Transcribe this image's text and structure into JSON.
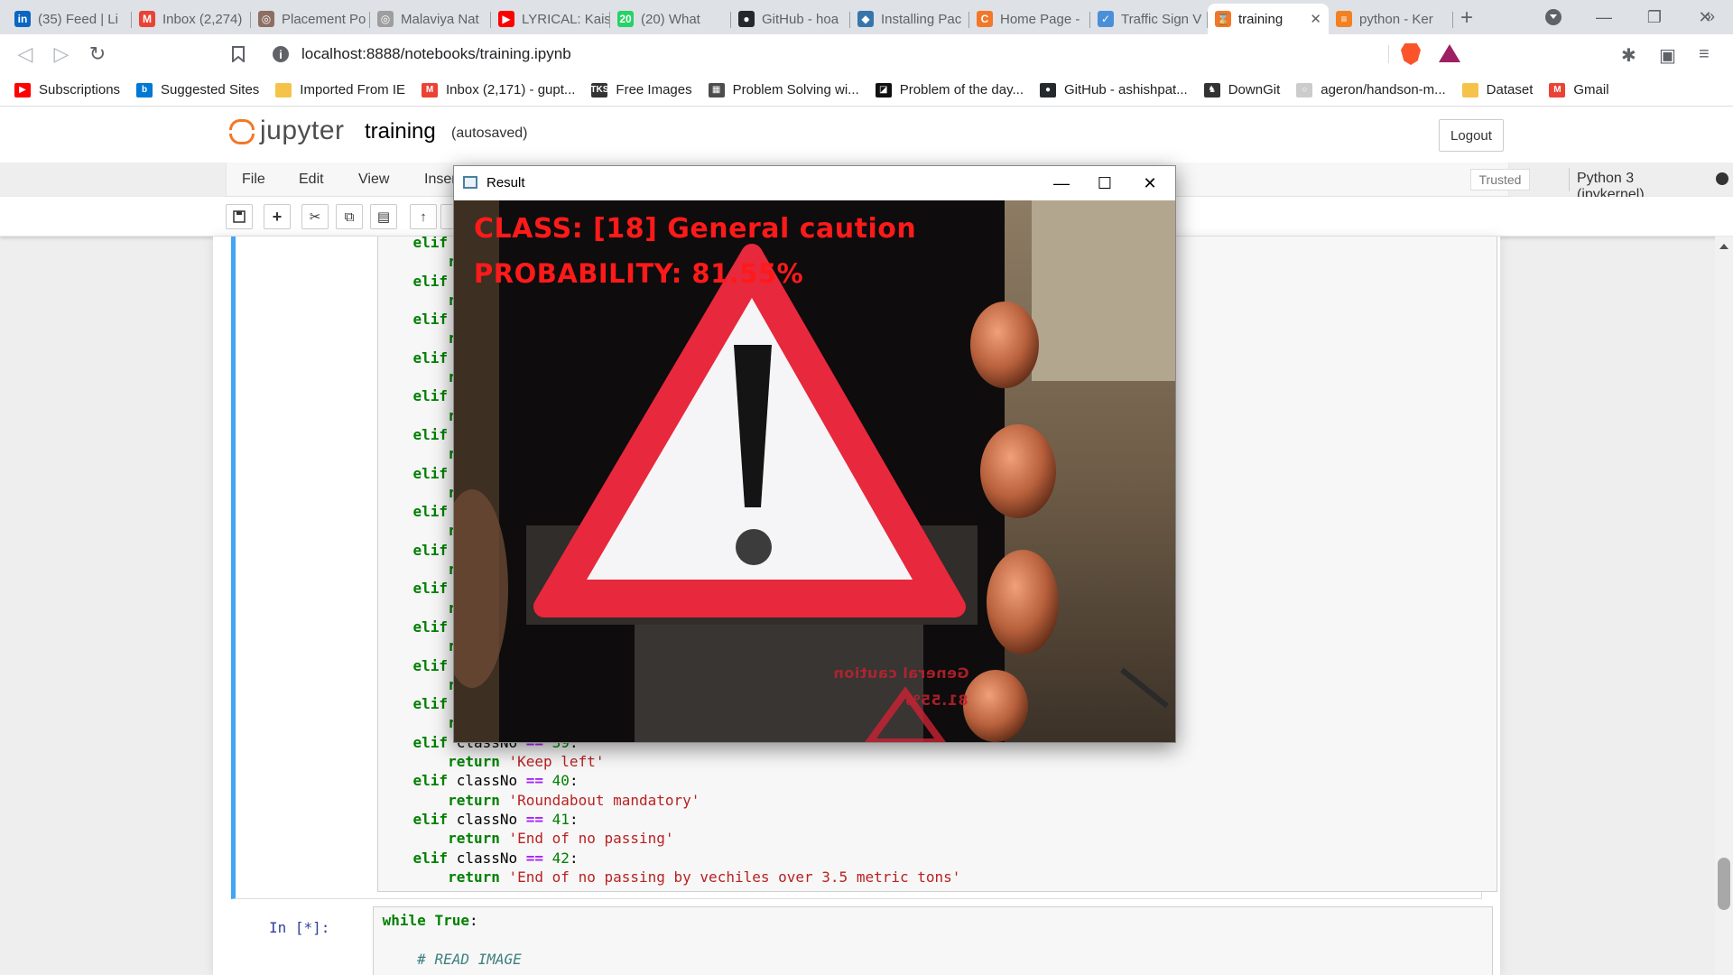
{
  "browser": {
    "tabs": [
      {
        "title": "(35) Feed | Li",
        "icon": "linkedin-icon",
        "color": "#0a66c2",
        "glyph": "in"
      },
      {
        "title": "Inbox (2,274)",
        "icon": "gmail-icon",
        "color": "#ea4335",
        "glyph": "M"
      },
      {
        "title": "Placement Po",
        "icon": "placement-icon",
        "color": "#8d6e63",
        "glyph": "◎"
      },
      {
        "title": "Malaviya Nat",
        "icon": "malaviya-icon",
        "color": "#9e9e9e",
        "glyph": "◎"
      },
      {
        "title": "LYRICAL: Kais",
        "icon": "youtube-icon",
        "color": "#ff0000",
        "glyph": "▶"
      },
      {
        "title": "(20) What",
        "icon": "whatsapp-icon",
        "color": "#25d366",
        "glyph": "20"
      },
      {
        "title": "GitHub - hoa",
        "icon": "github-icon",
        "color": "#24292e",
        "glyph": "●"
      },
      {
        "title": "Installing Pac",
        "icon": "python-icon",
        "color": "#3776ab",
        "glyph": "◆"
      },
      {
        "title": "Home Page -",
        "icon": "jupyter-icon",
        "color": "#f37726",
        "glyph": "C"
      },
      {
        "title": "Traffic Sign V",
        "icon": "traffic-icon",
        "color": "#4a90d9",
        "glyph": "✓"
      },
      {
        "title": "training",
        "icon": "hourglass-icon",
        "color": "#f37726",
        "glyph": "⌛",
        "active": true
      },
      {
        "title": "python - Ker",
        "icon": "stackoverflow-icon",
        "color": "#f48024",
        "glyph": "≡"
      }
    ],
    "url": "localhost:8888/notebooks/training.ipynb",
    "bookmarks": [
      {
        "label": "Subscriptions",
        "icon": "youtube-icon",
        "color": "#ff0000",
        "glyph": "▶"
      },
      {
        "label": "Suggested Sites",
        "icon": "bing-icon",
        "color": "#0078d4",
        "glyph": "b"
      },
      {
        "label": "Imported From IE",
        "icon": "folder-icon",
        "color": "#f6c34a",
        "glyph": ""
      },
      {
        "label": "Inbox (2,171) - gupt...",
        "icon": "gmail-icon",
        "color": "#ea4335",
        "glyph": "M"
      },
      {
        "label": "Free Images",
        "icon": "freeimages-icon",
        "color": "#333333",
        "glyph": "TKS"
      },
      {
        "label": "Problem Solving wi...",
        "icon": "runestone-icon",
        "color": "#4d4d4d",
        "glyph": "▦"
      },
      {
        "label": "Problem of the day...",
        "icon": "gfg-icon",
        "color": "#111111",
        "glyph": "◪"
      },
      {
        "label": "GitHub - ashishpat...",
        "icon": "github-icon",
        "color": "#24292e",
        "glyph": "●"
      },
      {
        "label": "DownGit",
        "icon": "downgit-icon",
        "color": "#333333",
        "glyph": "♞"
      },
      {
        "label": "ageron/handson-m...",
        "icon": "github-icon",
        "color": "#cccccc",
        "glyph": "○"
      },
      {
        "label": "Dataset",
        "icon": "folder-icon",
        "color": "#f6c34a",
        "glyph": ""
      },
      {
        "label": "Gmail",
        "icon": "gmail-icon",
        "color": "#ea4335",
        "glyph": "M"
      }
    ]
  },
  "jupyter": {
    "logo_text": "jupyter",
    "notebook_name": "training",
    "autosave": "(autosaved)",
    "logout": "Logout",
    "menu": [
      "File",
      "Edit",
      "View",
      "Inser"
    ],
    "trusted": "Trusted",
    "kernel": "Python 3 (ipykernel)",
    "toolbar_icons": [
      "save-icon",
      "add-cell-icon",
      "cut-icon",
      "copy-icon",
      "paste-icon",
      "move-up-icon",
      "move-down-icon"
    ],
    "code_top_lines": [
      [
        "elif cl",
        ""
      ],
      [
        "",
        "ret"
      ],
      [
        "elif cl",
        ""
      ],
      [
        "",
        "ret"
      ],
      [
        "elif cl",
        ""
      ],
      [
        "",
        "ret"
      ],
      [
        "elif cl",
        ""
      ],
      [
        "",
        "ret"
      ],
      [
        "elif cl",
        ""
      ],
      [
        "",
        "ret"
      ],
      [
        "elif cl",
        ""
      ],
      [
        "",
        "ret"
      ],
      [
        "elif cl",
        ""
      ],
      [
        "",
        "ret"
      ],
      [
        "elif cl",
        ""
      ],
      [
        "",
        "ret"
      ],
      [
        "elif cl",
        ""
      ],
      [
        "",
        "ret"
      ],
      [
        "elif cl",
        ""
      ],
      [
        "",
        "ret"
      ],
      [
        "elif cl",
        ""
      ],
      [
        "",
        "ret"
      ],
      [
        "elif cl",
        ""
      ],
      [
        "",
        "ret"
      ],
      [
        "elif cl",
        ""
      ],
      [
        "",
        "ret"
      ]
    ],
    "code_bottom": [
      {
        "kw": "elif",
        "rest": " classNo ",
        "op": "==",
        "num": "39",
        "end": ":"
      },
      {
        "ret": "return",
        "str": "'Keep left'"
      },
      {
        "kw": "elif",
        "rest": " classNo ",
        "op": "==",
        "num": "40",
        "end": ":"
      },
      {
        "ret": "return",
        "str": "'Roundabout mandatory'"
      },
      {
        "kw": "elif",
        "rest": " classNo ",
        "op": "==",
        "num": "41",
        "end": ":"
      },
      {
        "ret": "return",
        "str": "'End of no passing'"
      },
      {
        "kw": "elif",
        "rest": " classNo ",
        "op": "==",
        "num": "42",
        "end": ":"
      },
      {
        "ret": "return",
        "str": "'End of no passing by vechiles over 3.5 metric tons'"
      }
    ],
    "cell2_prompt": "In [*]:",
    "cell2_line1_kw": "while",
    "cell2_line1_kw2": "True",
    "cell2_line1_end": ":",
    "cell2_comment": "# READ IMAGE"
  },
  "result_window": {
    "title": "Result",
    "class_text": "CLASS:  [18] General caution",
    "probability_text": "PROBABILITY: 81.55%",
    "mirrored_text_1": "General caution",
    "mirrored_text_2": "81.55%",
    "text_color": "#ff1a1a"
  }
}
